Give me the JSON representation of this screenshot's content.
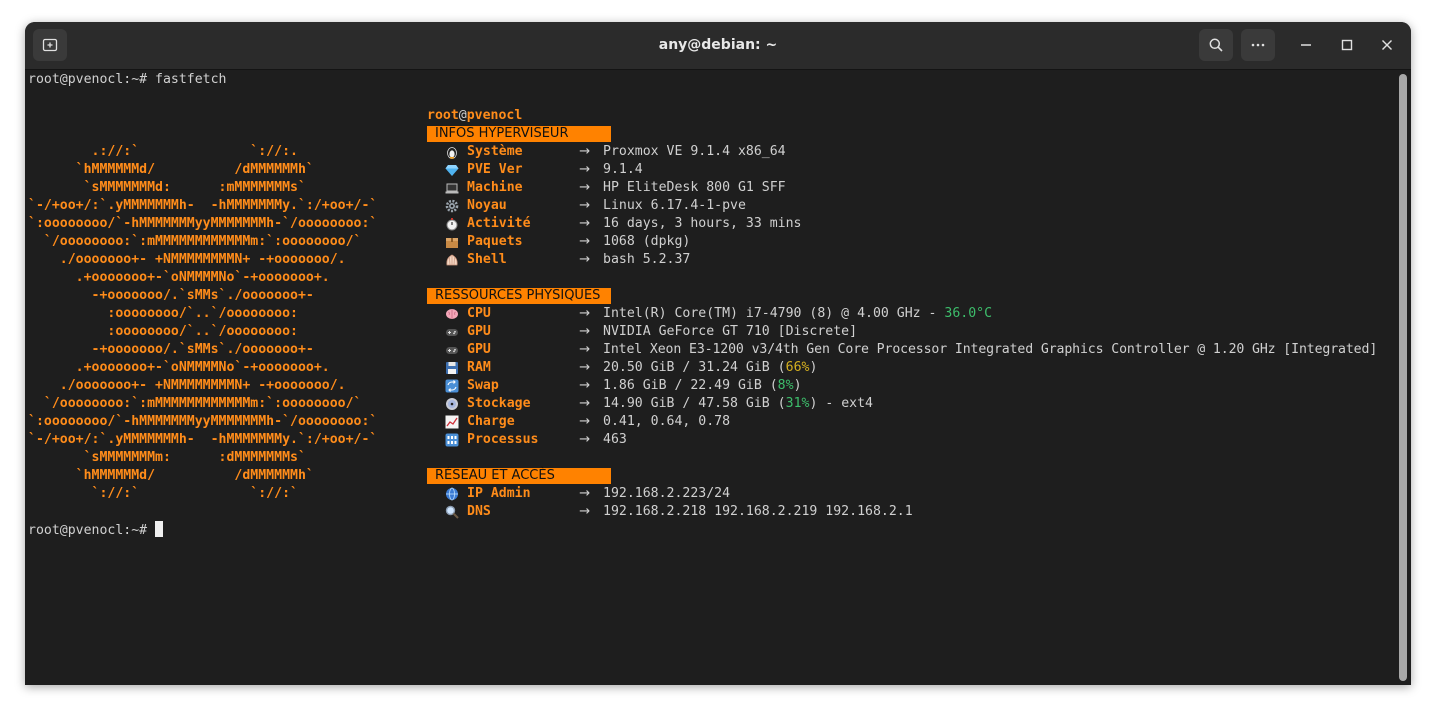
{
  "window": {
    "title": "any@debian: ~"
  },
  "prompt1": "root@pvenocl:~# fastfetch",
  "prompt2": "root@pvenocl:~# ",
  "logo_lines": [
    "        .://:`              `://:.",
    "      `hMMMMMMd/          /dMMMMMMh`",
    "       `sMMMMMMMd:      :mMMMMMMMs`",
    "`-/+oo+/:`.yMMMMMMMh-  -hMMMMMMMy.`:/+oo+/-`",
    "`:oooooooo/`-hMMMMMMMyyMMMMMMMh-`/oooooooo:`",
    "  `/oooooooo:`:mMMMMMMMMMMMMm:`:oooooooo/`",
    "    ./ooooooo+- +NMMMMMMMMN+ -+ooooooo/.",
    "      .+ooooooo+-`oNMMMMNo`-+ooooooo+.",
    "        -+ooooooo/.`sMMs`./ooooooo+-",
    "          :oooooooo/`..`/oooooooo:",
    "          :oooooooo/`..`/oooooooo:",
    "        -+ooooooo/.`sMMs`./ooooooo+-",
    "      .+ooooooo+-`oNMMMMNo`-+ooooooo+.",
    "    ./ooooooo+- +NMMMMMMMMN+ -+ooooooo/.",
    "  `/oooooooo:`:mMMMMMMMMMMMMm:`:oooooooo/`",
    "`:oooooooo/`-hMMMMMMMyyMMMMMMMh-`/oooooooo:`",
    "`-/+oo+/:`.yMMMMMMMh-  -hMMMMMMMy.`:/+oo+/-`",
    "       `sMMMMMMMm:      :dMMMMMMMs`",
    "      `hMMMMMMd/          /dMMMMMMh`",
    "        `://:`              `://:`"
  ],
  "header": {
    "user": "root",
    "at": "@",
    "host": "pvenocl"
  },
  "sections": {
    "hyper": "INFOS HYPERVISEUR",
    "res": "RESSOURCES PHYSIQUES",
    "net": "RÉSEAU ET ACCÈS"
  },
  "arrow": "→",
  "info": {
    "system": {
      "icon": "penguin-icon",
      "key": "Système",
      "value": "Proxmox VE 9.1.4 x86_64"
    },
    "pve": {
      "icon": "gem-icon",
      "key": "PVE Ver",
      "value": "9.1.4"
    },
    "machine": {
      "icon": "laptop-icon",
      "key": "Machine",
      "value": "HP EliteDesk 800 G1 SFF"
    },
    "kernel": {
      "icon": "gear-icon",
      "key": "Noyau",
      "value": "Linux 6.17.4-1-pve"
    },
    "uptime": {
      "icon": "stopwatch-icon",
      "key": "Activité",
      "value": "16 days, 3 hours, 33 mins"
    },
    "packages": {
      "icon": "package-icon",
      "key": "Paquets",
      "value": "1068 (dpkg)"
    },
    "shell": {
      "icon": "shell-icon",
      "key": "Shell",
      "value": "bash 5.2.37"
    },
    "cpu": {
      "icon": "brain-icon",
      "key": "CPU",
      "value": "Intel(R) Core(TM) i7-4790 (8) @ 4.00 GHz - ",
      "temp": "36.0°C"
    },
    "gpu1": {
      "icon": "gamepad-icon",
      "key": "GPU",
      "value": "NVIDIA GeForce GT 710 [Discrete]"
    },
    "gpu2": {
      "icon": "gamepad-icon",
      "key": "GPU",
      "value": "Intel Xeon E3-1200 v3/4th Gen Core Processor Integrated Graphics Controller @ 1.20 GHz [Integrated]"
    },
    "ram": {
      "icon": "floppy-disk-icon",
      "key": "RAM",
      "pre": "20.50 GiB / 31.24 GiB (",
      "pct": "66%",
      "post": ")"
    },
    "swap": {
      "icon": "swap-icon",
      "key": "Swap",
      "pre": "1.86 GiB / 22.49 GiB (",
      "pct": "8%",
      "post": ")"
    },
    "disk": {
      "icon": "disc-icon",
      "key": "Stockage",
      "pre": "14.90 GiB / 47.58 GiB (",
      "pct": "31%",
      "post": ") - ext4"
    },
    "load": {
      "icon": "chart-icon",
      "key": "Charge",
      "value": "0.41, 0.64, 0.78"
    },
    "procs": {
      "icon": "numbers-icon",
      "key": "Processus",
      "value": "463"
    },
    "ip": {
      "icon": "globe-icon",
      "key": "IP Admin",
      "value": "192.168.2.223/24"
    },
    "dns": {
      "icon": "magnifier-icon",
      "key": "DNS",
      "value": "192.168.2.218 192.168.2.219 192.168.2.1"
    }
  },
  "colors": {
    "accent": "#ff8200",
    "good": "#3dbd6b",
    "warn": "#d5b020",
    "bg": "#1e1e1e"
  }
}
